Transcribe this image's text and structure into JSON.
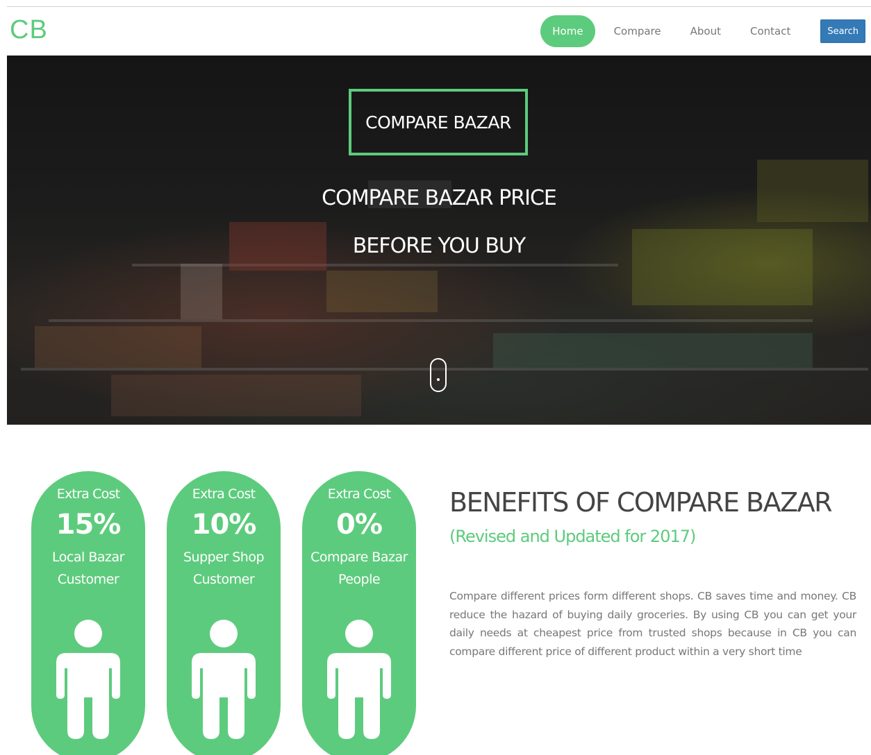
{
  "navbar": {
    "logo": "CB",
    "links": [
      {
        "label": "Home",
        "active": true
      },
      {
        "label": "Compare",
        "active": false
      },
      {
        "label": "About",
        "active": false
      },
      {
        "label": "Contact",
        "active": false
      }
    ],
    "search_label": "Search"
  },
  "hero": {
    "brand": "COMPARE BAZAR",
    "line1": "COMPARE BAZAR PRICE",
    "line2": "BEFORE YOU BUY",
    "scroll_icon": "mouse-scroll-icon"
  },
  "stats": [
    {
      "label": "Extra Cost",
      "value": "15%",
      "who_line1": "Local Bazar",
      "who_line2": "Customer",
      "icon": "person-icon"
    },
    {
      "label": "Extra Cost",
      "value": "10%",
      "who_line1": "Supper Shop",
      "who_line2": "Customer",
      "icon": "person-icon"
    },
    {
      "label": "Extra Cost",
      "value": "0%",
      "who_line1": "Compare Bazar",
      "who_line2": "People",
      "icon": "person-icon"
    }
  ],
  "benefits": {
    "title": "BENEFITS OF COMPARE BAZAR",
    "subtitle": "(Revised and Updated for 2017)",
    "body": "Compare different prices form different shops. CB saves time and money. CB reduce the hazard of buying daily groceries. By using CB you can get your daily needs at cheapest price from trusted shops because in CB you can compare different price of different product within a very short time"
  },
  "colors": {
    "accent": "#5dcb7d",
    "search_button": "#337ab7",
    "hero_overlay": "#1c1c1c"
  }
}
